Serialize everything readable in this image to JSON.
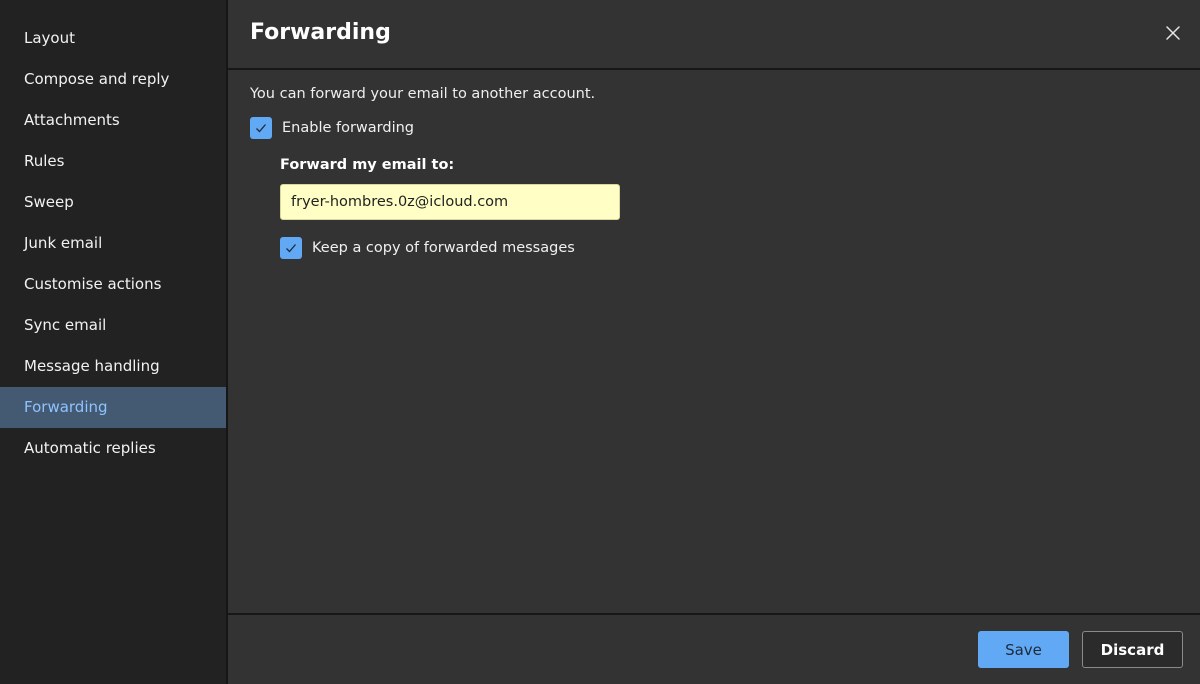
{
  "sidebar": {
    "items": [
      {
        "label": "Layout",
        "active": false
      },
      {
        "label": "Compose and reply",
        "active": false
      },
      {
        "label": "Attachments",
        "active": false
      },
      {
        "label": "Rules",
        "active": false
      },
      {
        "label": "Sweep",
        "active": false
      },
      {
        "label": "Junk email",
        "active": false
      },
      {
        "label": "Customise actions",
        "active": false
      },
      {
        "label": "Sync email",
        "active": false
      },
      {
        "label": "Message handling",
        "active": false
      },
      {
        "label": "Forwarding",
        "active": true
      },
      {
        "label": "Automatic replies",
        "active": false
      }
    ]
  },
  "header": {
    "title": "Forwarding",
    "close_icon": "close-icon"
  },
  "content": {
    "description": "You can forward your email to another account.",
    "enable_forwarding": {
      "label": "Enable forwarding",
      "checked": true
    },
    "forward_to_label": "Forward my email to:",
    "forward_to_value": "fryer-hombres.0z@icloud.com",
    "keep_copy": {
      "label": "Keep a copy of forwarded messages",
      "checked": true
    }
  },
  "footer": {
    "save_label": "Save",
    "discard_label": "Discard"
  },
  "colors": {
    "accent": "#62a9f5",
    "active_nav_bg": "#445a72",
    "active_nav_text": "#8ec3ff",
    "input_bg": "#ffffc5"
  }
}
